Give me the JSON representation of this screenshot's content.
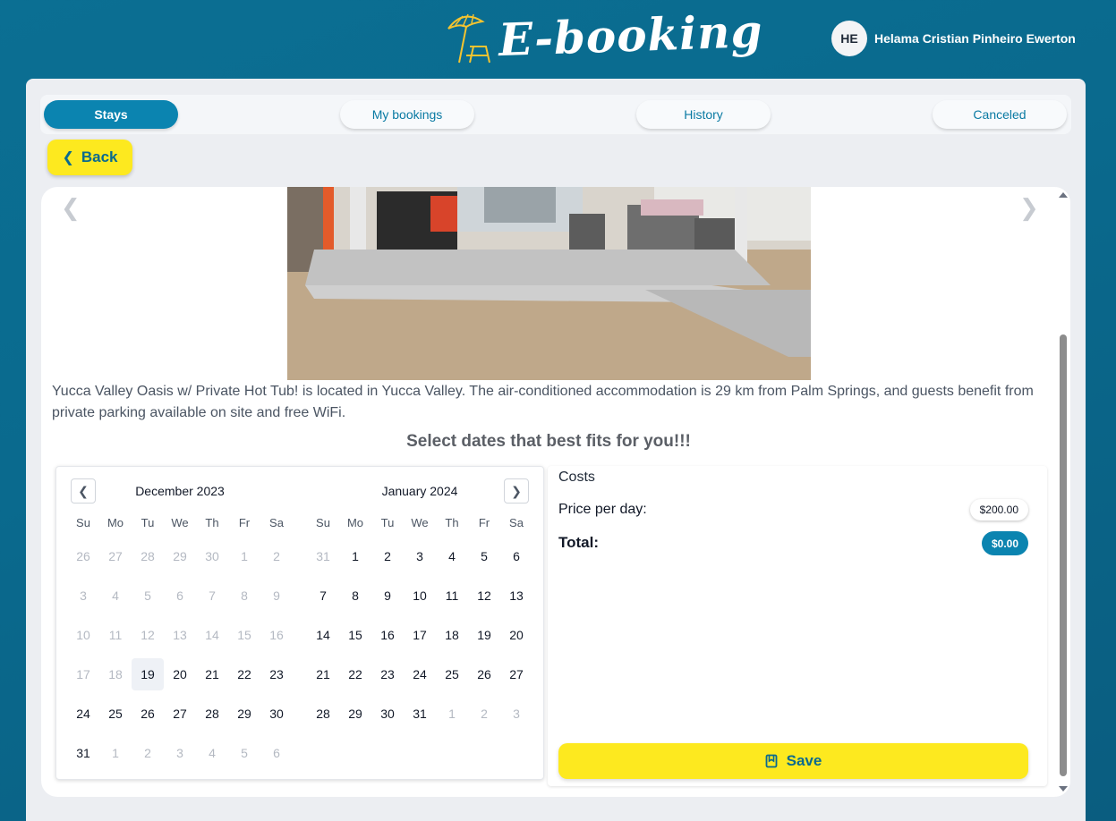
{
  "header": {
    "logo_text": "E-booking",
    "user_initials": "HE",
    "user_name": "Helama Cristian Pinheiro Ewerton"
  },
  "tabs": [
    {
      "label": "Stays",
      "active": true
    },
    {
      "label": "My bookings",
      "active": false
    },
    {
      "label": "History",
      "active": false
    },
    {
      "label": "Canceled",
      "active": false
    }
  ],
  "back_label": "Back",
  "stay": {
    "description": "Yucca Valley Oasis w/ Private Hot Tub! is located in Yucca Valley. The air-conditioned accommodation is 29 km from Palm Springs, and guests benefit from private parking available on site and free WiFi.",
    "select_title": "Select dates that best fits for you!!!"
  },
  "calendar": {
    "weekdays": [
      "Su",
      "Mo",
      "Tu",
      "We",
      "Th",
      "Fr",
      "Sa"
    ],
    "months": [
      {
        "title": "December 2023",
        "weeks": [
          [
            {
              "d": "26",
              "m": 1
            },
            {
              "d": "27",
              "m": 1
            },
            {
              "d": "28",
              "m": 1
            },
            {
              "d": "29",
              "m": 1
            },
            {
              "d": "30",
              "m": 1
            },
            {
              "d": "1",
              "m": 1
            },
            {
              "d": "2",
              "m": 1
            }
          ],
          [
            {
              "d": "3",
              "m": 1
            },
            {
              "d": "4",
              "m": 1
            },
            {
              "d": "5",
              "m": 1
            },
            {
              "d": "6",
              "m": 1
            },
            {
              "d": "7",
              "m": 1
            },
            {
              "d": "8",
              "m": 1
            },
            {
              "d": "9",
              "m": 1
            }
          ],
          [
            {
              "d": "10",
              "m": 1
            },
            {
              "d": "11",
              "m": 1
            },
            {
              "d": "12",
              "m": 1
            },
            {
              "d": "13",
              "m": 1
            },
            {
              "d": "14",
              "m": 1
            },
            {
              "d": "15",
              "m": 1
            },
            {
              "d": "16",
              "m": 1
            }
          ],
          [
            {
              "d": "17",
              "m": 1
            },
            {
              "d": "18",
              "m": 1
            },
            {
              "d": "19",
              "m": 0,
              "t": 1
            },
            {
              "d": "20",
              "m": 0
            },
            {
              "d": "21",
              "m": 0
            },
            {
              "d": "22",
              "m": 0
            },
            {
              "d": "23",
              "m": 0
            }
          ],
          [
            {
              "d": "24",
              "m": 0
            },
            {
              "d": "25",
              "m": 0
            },
            {
              "d": "26",
              "m": 0
            },
            {
              "d": "27",
              "m": 0
            },
            {
              "d": "28",
              "m": 0
            },
            {
              "d": "29",
              "m": 0
            },
            {
              "d": "30",
              "m": 0
            }
          ],
          [
            {
              "d": "31",
              "m": 0
            },
            {
              "d": "1",
              "m": 1
            },
            {
              "d": "2",
              "m": 1
            },
            {
              "d": "3",
              "m": 1
            },
            {
              "d": "4",
              "m": 1
            },
            {
              "d": "5",
              "m": 1
            },
            {
              "d": "6",
              "m": 1
            }
          ]
        ]
      },
      {
        "title": "January 2024",
        "weeks": [
          [
            {
              "d": "31",
              "m": 1
            },
            {
              "d": "1",
              "m": 0
            },
            {
              "d": "2",
              "m": 0
            },
            {
              "d": "3",
              "m": 0
            },
            {
              "d": "4",
              "m": 0
            },
            {
              "d": "5",
              "m": 0
            },
            {
              "d": "6",
              "m": 0
            }
          ],
          [
            {
              "d": "7",
              "m": 0
            },
            {
              "d": "8",
              "m": 0
            },
            {
              "d": "9",
              "m": 0
            },
            {
              "d": "10",
              "m": 0
            },
            {
              "d": "11",
              "m": 0
            },
            {
              "d": "12",
              "m": 0
            },
            {
              "d": "13",
              "m": 0
            }
          ],
          [
            {
              "d": "14",
              "m": 0
            },
            {
              "d": "15",
              "m": 0
            },
            {
              "d": "16",
              "m": 0
            },
            {
              "d": "17",
              "m": 0
            },
            {
              "d": "18",
              "m": 0
            },
            {
              "d": "19",
              "m": 0
            },
            {
              "d": "20",
              "m": 0
            }
          ],
          [
            {
              "d": "21",
              "m": 0
            },
            {
              "d": "22",
              "m": 0
            },
            {
              "d": "23",
              "m": 0
            },
            {
              "d": "24",
              "m": 0
            },
            {
              "d": "25",
              "m": 0
            },
            {
              "d": "26",
              "m": 0
            },
            {
              "d": "27",
              "m": 0
            }
          ],
          [
            {
              "d": "28",
              "m": 0
            },
            {
              "d": "29",
              "m": 0
            },
            {
              "d": "30",
              "m": 0
            },
            {
              "d": "31",
              "m": 0
            },
            {
              "d": "1",
              "m": 1
            },
            {
              "d": "2",
              "m": 1
            },
            {
              "d": "3",
              "m": 1
            }
          ]
        ]
      }
    ]
  },
  "costs": {
    "title": "Costs",
    "price_label": "Price per day:",
    "price_value": "$200.00",
    "total_label": "Total:",
    "total_value": "$0.00",
    "save_label": "Save"
  },
  "colors": {
    "primary": "#0b84b0",
    "accent_yellow": "#fde91f",
    "background": "#0a6a8e"
  }
}
